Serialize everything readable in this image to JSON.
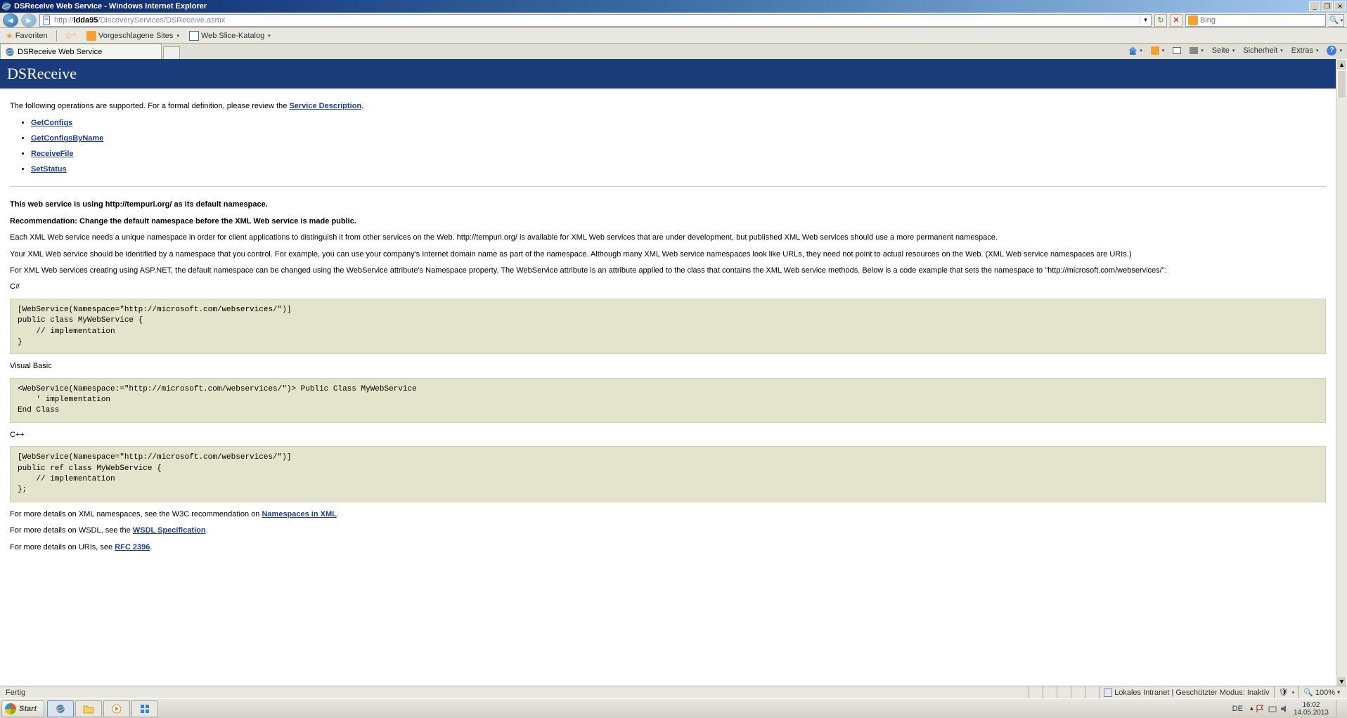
{
  "window": {
    "title": "DSReceive Web Service - Windows Internet Explorer"
  },
  "address": {
    "url_prefix": "http://",
    "url_host": "ldda95",
    "url_path": "/DiscoveryServices/DSReceive.asmx",
    "search_placeholder": "Bing"
  },
  "favorites": {
    "label": "Favoriten",
    "suggested": "Vorgeschlagene Sites",
    "webslice": "Web Slice-Katalog"
  },
  "tabs": {
    "active": "DSReceive Web Service"
  },
  "command_bar": {
    "page": "Seite",
    "safety": "Sicherheit",
    "extras": "Extras"
  },
  "page": {
    "banner": "DSReceive",
    "intro_prefix": "The following operations are supported. For a formal definition, please review the ",
    "intro_link": "Service Description",
    "intro_suffix": ".",
    "ops": {
      "0": "GetConfigs",
      "1": "GetConfigsByName",
      "2": "ReceiveFile",
      "3": "SetStatus"
    },
    "ns_bold1": "This web service is using http://tempuri.org/ as its default namespace.",
    "ns_bold2": "Recommendation: Change the default namespace before the XML Web service is made public.",
    "ns_p1": "Each XML Web service needs a unique namespace in order for client applications to distinguish it from other services on the Web. http://tempuri.org/ is available for XML Web services that are under development, but published XML Web services should use a more permanent namespace.",
    "ns_p2": "Your XML Web service should be identified by a namespace that you control. For example, you can use your company's Internet domain name as part of the namespace. Although many XML Web service namespaces look like URLs, they need not point to actual resources on the Web. (XML Web service namespaces are URIs.)",
    "ns_p3": "For XML Web services creating using ASP.NET, the default namespace can be changed using the WebService attribute's Namespace property. The WebService attribute is an attribute applied to the class that contains the XML Web service methods. Below is a code example that sets the namespace to \"http://microsoft.com/webservices/\":",
    "lang_cs": "C#",
    "code_cs": "[WebService(Namespace=\"http://microsoft.com/webservices/\")]\npublic class MyWebService {\n    // implementation\n}",
    "lang_vb": "Visual Basic",
    "code_vb": "<WebService(Namespace:=\"http://microsoft.com/webservices/\")> Public Class MyWebService\n    ' implementation\nEnd Class",
    "lang_cpp": "C++",
    "code_cpp": "[WebService(Namespace=\"http://microsoft.com/webservices/\")]\npublic ref class MyWebService {\n    // implementation\n};",
    "more1_pre": "For more details on XML namespaces, see the W3C recommendation on ",
    "more1_link": "Namespaces in XML",
    "more1_suf": ".",
    "more2_pre": "For more details on WSDL, see the ",
    "more2_link": "WSDL Specification",
    "more2_suf": ".",
    "more3_pre": "For more details on URIs, see ",
    "more3_link": "RFC 2396",
    "more3_suf": "."
  },
  "status": {
    "done": "Fertig",
    "zone": "Lokales Intranet | Geschützter Modus: Inaktiv",
    "zoom": "100%"
  },
  "taskbar": {
    "start": "Start",
    "lang": "DE",
    "time": "16:02",
    "date": "14.05.2013"
  }
}
